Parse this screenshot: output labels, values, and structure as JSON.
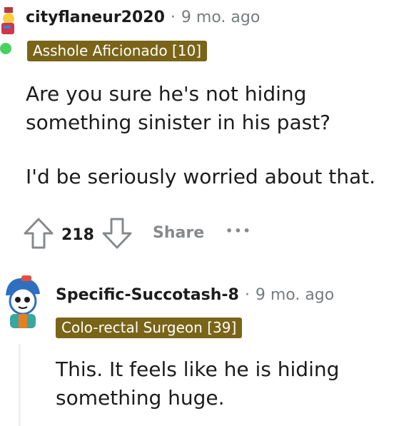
{
  "comment1": {
    "username": "cityflaneur2020",
    "separator": "·",
    "time": "9 mo. ago",
    "flair": "Asshole Aficionado [10]",
    "paragraphs": [
      "Are you sure he's not hiding something sinister in his past?",
      "I'd be seriously worried about that."
    ],
    "votes": "218",
    "share_label": "Share",
    "more_label": "•••"
  },
  "comment2": {
    "username": "Specific-Succotash-8",
    "separator": "·",
    "time": "9 mo. ago",
    "flair": "Colo-rectal Surgeon [39]",
    "text": "This. It feels like he is hiding something huge."
  },
  "colors": {
    "flair_bg": "#7a6418",
    "online": "#46d160",
    "meta": "#787c7e"
  }
}
